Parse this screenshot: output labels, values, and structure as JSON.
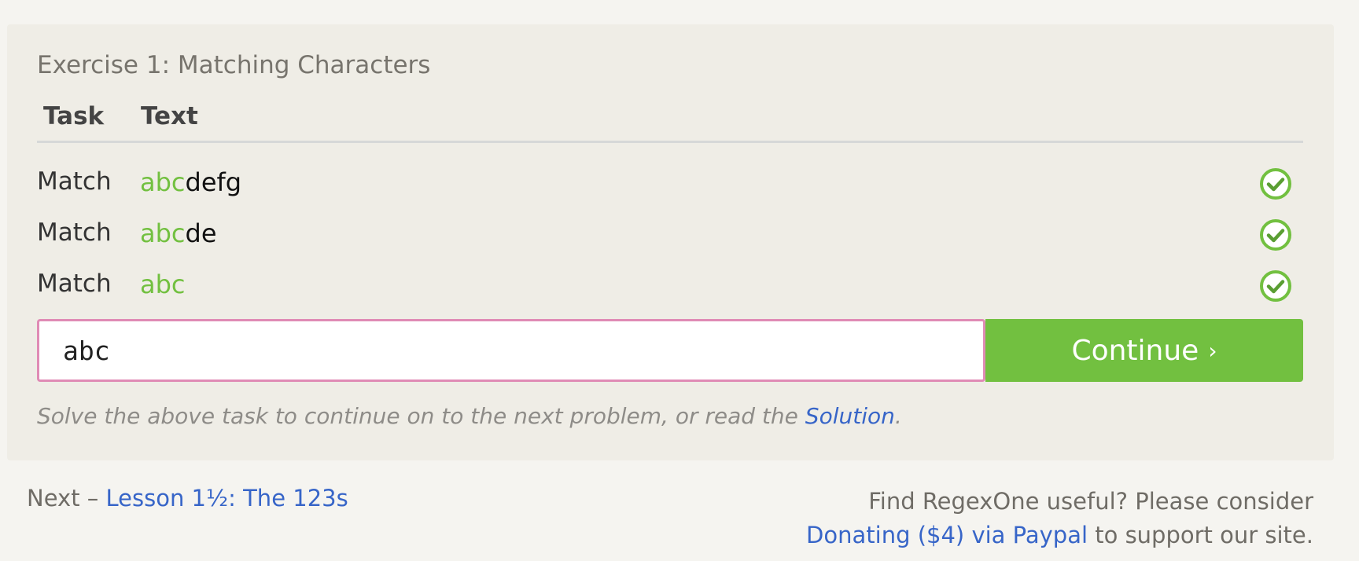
{
  "exercise": {
    "title": "Exercise 1: Matching Characters",
    "column_headers": {
      "task": "Task",
      "text": "Text"
    },
    "rows": [
      {
        "task": "Match",
        "matched": "abc",
        "rest": "defg",
        "status": "passed",
        "status_icon": "check-circle-icon"
      },
      {
        "task": "Match",
        "matched": "abc",
        "rest": "de",
        "status": "passed",
        "status_icon": "check-circle-icon"
      },
      {
        "task": "Match",
        "matched": "abc",
        "rest": "",
        "status": "passed",
        "status_icon": "check-circle-icon"
      }
    ],
    "input": {
      "value": "abc",
      "placeholder": ""
    },
    "continue_button": {
      "label": "Continue",
      "chevron": "›"
    },
    "hint": {
      "prefix": "Solve the above task to continue on to the next problem, or read the ",
      "link_text": "Solution",
      "suffix": "."
    }
  },
  "footer": {
    "next_prefix": "Next – ",
    "next_link": "Lesson 1½: The 123s",
    "donate_line1": "Find RegexOne useful? Please consider",
    "donate_link": "Donating ($4) via Paypal",
    "donate_suffix": " to support our site."
  },
  "colors": {
    "match_green": "#72c040",
    "input_border_pink": "#e08bb5",
    "link_blue": "#3765c8",
    "panel_bg": "#efede6",
    "page_bg": "#f5f4f0"
  }
}
